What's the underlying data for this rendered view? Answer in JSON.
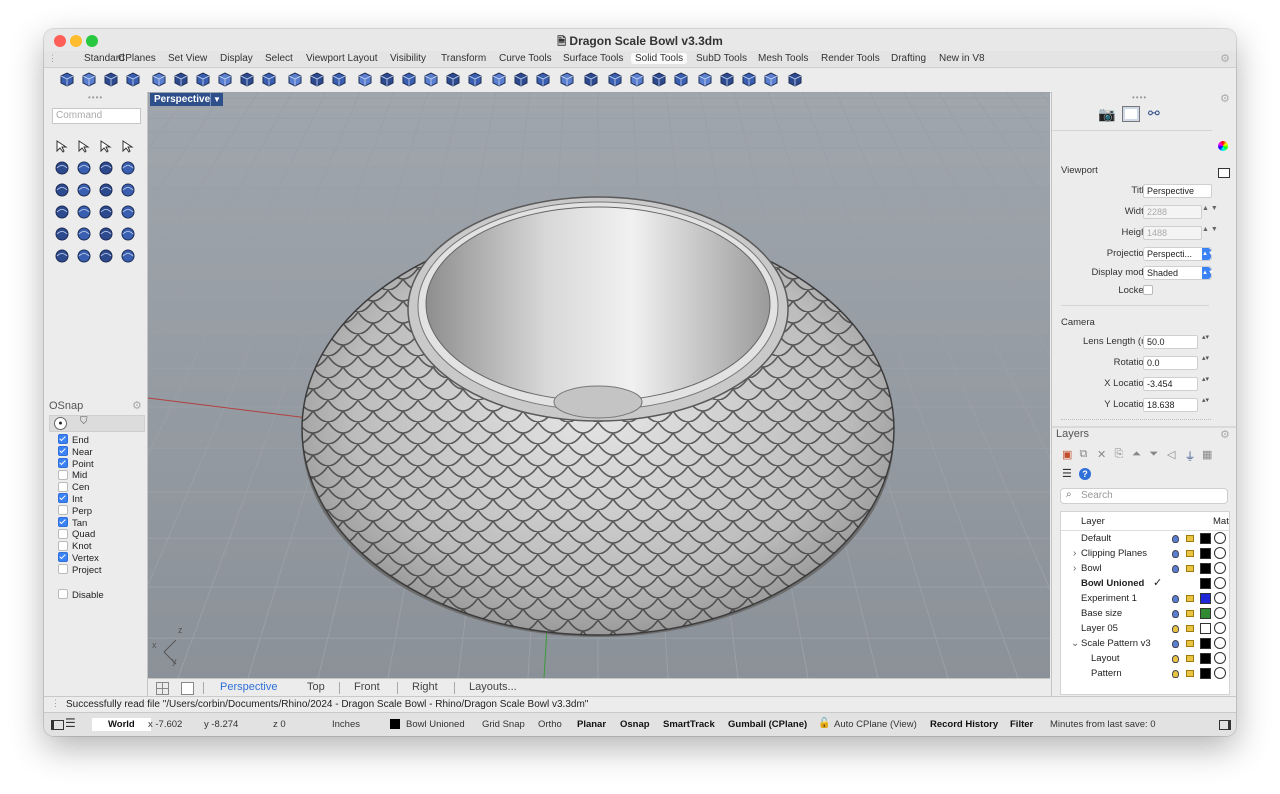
{
  "window": {
    "title": "Dragon Scale Bowl v3.3dm",
    "colors": {
      "close": "#ff5f57",
      "minimize": "#febc2e",
      "zoom": "#28c840"
    }
  },
  "toolbar_tabs": [
    "Standard",
    "CPlanes",
    "Set View",
    "Display",
    "Select",
    "Viewport Layout",
    "Visibility",
    "Transform",
    "Curve Tools",
    "Surface Tools",
    "Solid Tools",
    "SubD Tools",
    "Mesh Tools",
    "Render Tools",
    "Drafting",
    "New in V8"
  ],
  "active_tab": "Solid Tools",
  "command": {
    "placeholder": "Command"
  },
  "osnap": {
    "title": "OSnap",
    "items": [
      {
        "label": "End",
        "checked": true
      },
      {
        "label": "Near",
        "checked": true
      },
      {
        "label": "Point",
        "checked": true
      },
      {
        "label": "Mid",
        "checked": false
      },
      {
        "label": "Cen",
        "checked": false
      },
      {
        "label": "Int",
        "checked": true
      },
      {
        "label": "Perp",
        "checked": false
      },
      {
        "label": "Tan",
        "checked": true
      },
      {
        "label": "Quad",
        "checked": false
      },
      {
        "label": "Knot",
        "checked": false
      },
      {
        "label": "Vertex",
        "checked": true
      },
      {
        "label": "Project",
        "checked": false
      }
    ],
    "disable": {
      "label": "Disable",
      "checked": false
    }
  },
  "viewport": {
    "label": "Perspective",
    "axes": {
      "x": "x",
      "y": "y",
      "z": "z"
    }
  },
  "viewport_tabs": [
    "Perspective",
    "Top",
    "Front",
    "Right",
    "Layouts..."
  ],
  "active_viewport_tab": "Perspective",
  "properties": {
    "viewport_section": "Viewport",
    "fields": [
      {
        "label": "Title",
        "value": "Perspective",
        "disabled": false,
        "kind": "text"
      },
      {
        "label": "Width",
        "value": "2288",
        "disabled": true,
        "kind": "number"
      },
      {
        "label": "Height",
        "value": "1488",
        "disabled": true,
        "kind": "number"
      },
      {
        "label": "Projection",
        "value": "Perspecti...",
        "kind": "select"
      },
      {
        "label": "Display mode",
        "value": "Shaded",
        "kind": "select"
      },
      {
        "label": "Locked",
        "value": "",
        "kind": "checkbox"
      }
    ],
    "camera_section": "Camera",
    "camera_fields": [
      {
        "label": "Lens Length (m",
        "value": "50.0"
      },
      {
        "label": "Rotation",
        "value": "0.0"
      },
      {
        "label": "X Location",
        "value": "-3.454"
      },
      {
        "label": "Y Location",
        "value": "18.638"
      }
    ]
  },
  "layers": {
    "title": "Layers",
    "search_placeholder": "Search",
    "col_layer": "Layer",
    "col_material": "Mat",
    "rows": [
      {
        "name": "Default",
        "indent": 0,
        "expander": "",
        "bold": false,
        "current": false,
        "color": "#000000",
        "bulb": "#5a7fd0"
      },
      {
        "name": "Clipping Planes",
        "indent": 0,
        "expander": "›",
        "bold": false,
        "current": false,
        "color": "#000000",
        "bulb": "#5a7fd0"
      },
      {
        "name": "Bowl",
        "indent": 0,
        "expander": "›",
        "bold": false,
        "current": false,
        "color": "#000000",
        "bulb": "#5a7fd0"
      },
      {
        "name": "Bowl Unioned",
        "indent": 0,
        "expander": "",
        "bold": true,
        "current": true,
        "color": "#000000",
        "bulb": ""
      },
      {
        "name": "Experiment 1",
        "indent": 0,
        "expander": "",
        "bold": false,
        "current": false,
        "color": "#1f27d6",
        "bulb": "#5a7fd0"
      },
      {
        "name": "Base size",
        "indent": 0,
        "expander": "",
        "bold": false,
        "current": false,
        "color": "#2f8a33",
        "bulb": "#5a7fd0"
      },
      {
        "name": "Layer 05",
        "indent": 0,
        "expander": "",
        "bold": false,
        "current": false,
        "color": "#ffffff",
        "bulb": "#e8c440"
      },
      {
        "name": "Scale Pattern v3",
        "indent": 0,
        "expander": "⌄",
        "bold": false,
        "current": false,
        "color": "#000000",
        "bulb": "#5a7fd0"
      },
      {
        "name": "Layout",
        "indent": 1,
        "expander": "",
        "bold": false,
        "current": false,
        "color": "#000000",
        "bulb": "#e8c440"
      },
      {
        "name": "Pattern",
        "indent": 1,
        "expander": "",
        "bold": false,
        "current": false,
        "color": "#000000",
        "bulb": "#e8c440"
      }
    ]
  },
  "status_message": "Successfully read file \"/Users/corbin/Documents/Rhino/2024 - Dragon Scale Bowl - Rhino/Dragon Scale Bowl v3.3dm\"",
  "statusbar": {
    "cplane": "World",
    "x": "x -7.602",
    "y": "y -8.274",
    "z": "z 0",
    "units": "Inches",
    "layer": "Bowl Unioned",
    "grid_snap": "Grid Snap",
    "ortho": "Ortho",
    "planar": "Planar",
    "osnap": "Osnap",
    "smarttrack": "SmartTrack",
    "gumball": "Gumball (CPlane)",
    "auto_cplane": "Auto CPlane (View)",
    "record_history": "Record History",
    "filter": "Filter",
    "minutes": "Minutes from last save: 0"
  }
}
